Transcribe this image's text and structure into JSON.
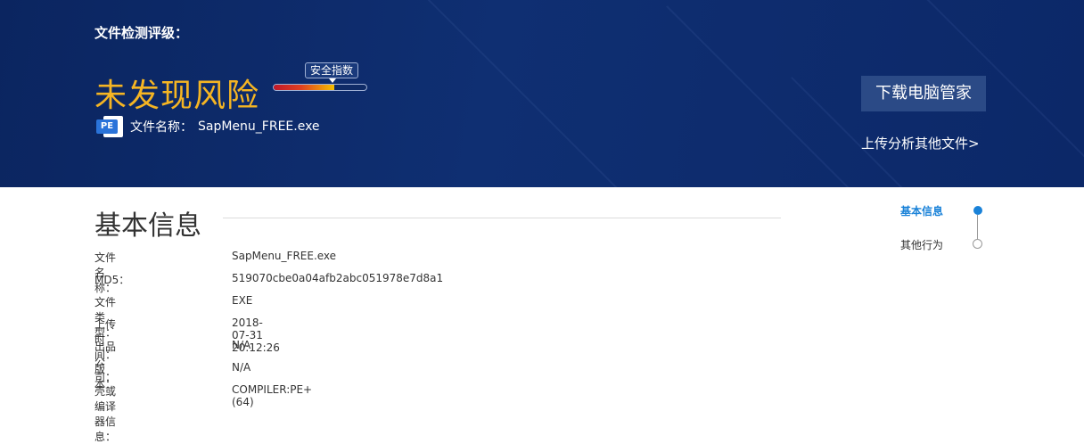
{
  "header": {
    "rating_label": "文件检测评级：",
    "verdict": "未发现风险",
    "safety_index_label": "安全指数",
    "safety_index_level": 0.65,
    "file_name_label": "文件名称：",
    "file_name": "SapMenu_FREE.exe",
    "file_icon_text": "PE",
    "download_button": "下载电脑管家",
    "upload_link": "上传分析其他文件>"
  },
  "basic_info": {
    "title": "基本信息",
    "rows": [
      {
        "key": "文件名称：",
        "value": "SapMenu_FREE.exe"
      },
      {
        "key": "MD5：",
        "value": "519070cbe0a04afb2abc051978e7d8a1"
      },
      {
        "key": "文件类型：",
        "value": "EXE"
      },
      {
        "key": "上传时间：",
        "value": "2018-07-31 20:12:26"
      },
      {
        "key": "出品公司：",
        "value": "N/A"
      },
      {
        "key": "版本：",
        "value": "N/A"
      },
      {
        "key": "壳或编译器信息：",
        "value": "COMPILER:PE+(64)"
      }
    ]
  },
  "side_nav": {
    "items": [
      {
        "label": "基本信息",
        "active": true
      },
      {
        "label": "其他行为",
        "active": false
      }
    ]
  },
  "colors": {
    "banner": "#0f2f72",
    "verdict": "#f5b523",
    "nav_active": "#1a82d8"
  }
}
